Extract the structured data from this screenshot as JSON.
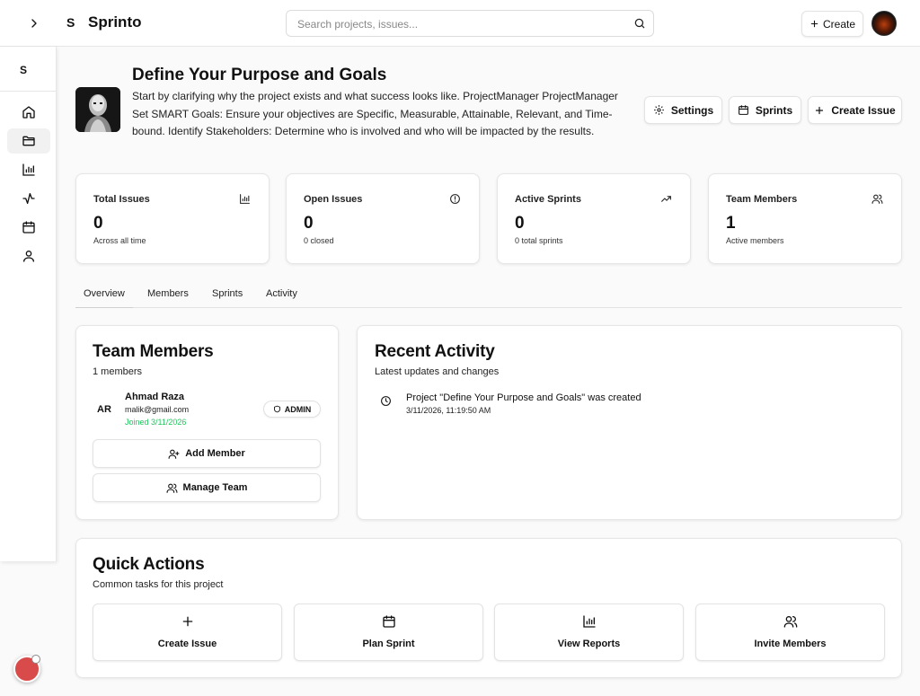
{
  "topbar": {
    "brand_initial": "S",
    "brand_name": "Sprinto",
    "search_placeholder": "Search projects, issues...",
    "create_label": "Create"
  },
  "sidebar": {
    "initial": "S",
    "items": [
      {
        "icon": "home-icon"
      },
      {
        "icon": "folder-icon",
        "active": true
      },
      {
        "icon": "bar-chart-icon"
      },
      {
        "icon": "activity-icon"
      },
      {
        "icon": "calendar-icon"
      },
      {
        "icon": "user-icon"
      }
    ]
  },
  "project": {
    "title": "Define Your Purpose and Goals",
    "description": "Start by clarifying why the project exists and what success looks like. ProjectManager ProjectManager Set SMART Goals: Ensure your objectives are Specific, Measurable, Attainable, Relevant, and Time-bound. Identify Stakeholders: Determine who is involved and who will be impacted by the results.",
    "buttons": {
      "settings": "Settings",
      "sprints": "Sprints",
      "create_issue": "Create Issue"
    }
  },
  "stats": [
    {
      "label": "Total Issues",
      "value": "0",
      "sub": "Across all time",
      "icon": "bar-chart-icon"
    },
    {
      "label": "Open Issues",
      "value": "0",
      "sub": "0 closed",
      "icon": "alert-circle-icon"
    },
    {
      "label": "Active Sprints",
      "value": "0",
      "sub": "0 total sprints",
      "icon": "trending-up-icon"
    },
    {
      "label": "Team Members",
      "value": "1",
      "sub": "Active members",
      "icon": "users-icon"
    }
  ],
  "tabs": [
    "Overview",
    "Members",
    "Sprints",
    "Activity"
  ],
  "team": {
    "title": "Team Members",
    "count_text": "1 members",
    "members": [
      {
        "initials": "AR",
        "name": "Ahmad Raza",
        "email": "malik@gmail.com",
        "joined": "Joined 3/11/2026",
        "role": "ADMIN"
      }
    ],
    "add_member": "Add Member",
    "manage_team": "Manage Team"
  },
  "activity": {
    "title": "Recent Activity",
    "subtitle": "Latest updates and changes",
    "items": [
      {
        "text": "Project \"Define Your Purpose and Goals\" was created",
        "time": "3/11/2026, 11:19:50 AM"
      }
    ]
  },
  "quick_actions": {
    "title": "Quick Actions",
    "subtitle": "Common tasks for this project",
    "items": [
      {
        "label": "Create Issue",
        "icon": "plus-icon"
      },
      {
        "label": "Plan Sprint",
        "icon": "calendar-icon"
      },
      {
        "label": "View Reports",
        "icon": "bar-chart-icon"
      },
      {
        "label": "Invite Members",
        "icon": "users-icon"
      }
    ]
  },
  "colors": {
    "accent_green": "#22c55e",
    "fab_red": "#d94a4a"
  }
}
